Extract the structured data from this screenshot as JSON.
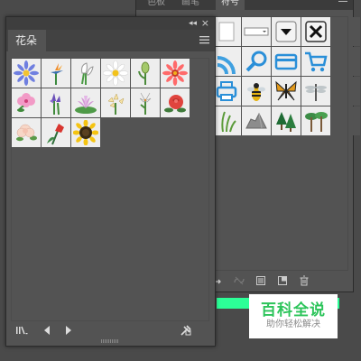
{
  "symbols_panel": {
    "tabs": [
      "色板",
      "画笔",
      "符号"
    ],
    "active_tab": "符号",
    "symbols": [
      {
        "name": "window-box-symbol"
      },
      {
        "name": "dropdown-field-symbol"
      },
      {
        "name": "dropdown-arrow-symbol"
      },
      {
        "name": "close-x-symbol"
      },
      {
        "name": "blank-symbol"
      },
      {
        "name": "rss-feed-symbol"
      },
      {
        "name": "magnifier-symbol"
      },
      {
        "name": "credit-card-symbol"
      },
      {
        "name": "shopping-cart-symbol"
      },
      {
        "name": "blank-symbol"
      },
      {
        "name": "printer-symbol"
      },
      {
        "name": "bee-symbol"
      },
      {
        "name": "butterfly-symbol"
      },
      {
        "name": "dragonfly-symbol"
      },
      {
        "name": "blank-symbol"
      },
      {
        "name": "grass-symbol"
      },
      {
        "name": "rock-symbol"
      },
      {
        "name": "pine-tree-symbol"
      },
      {
        "name": "palm-trees-symbol"
      },
      {
        "name": "blank-symbol"
      }
    ]
  },
  "flowers_panel": {
    "tab_label": "花朵",
    "flowers": [
      {
        "name": "aster",
        "color": "#6f7fe0"
      },
      {
        "name": "bird-of-paradise",
        "color": "#f08a2a"
      },
      {
        "name": "calla-lily",
        "color": "#ffffff"
      },
      {
        "name": "daisy",
        "color": "#ffffff"
      },
      {
        "name": "tulip-bud",
        "color": "#8fbf4a"
      },
      {
        "name": "gerbera",
        "color": "#ff6a6a"
      },
      {
        "name": "hibiscus",
        "color": "#f29ac6"
      },
      {
        "name": "iris",
        "color": "#6a4fb8"
      },
      {
        "name": "lotus",
        "color": "#d59ad8"
      },
      {
        "name": "lily-cluster",
        "color": "#f6e3a6"
      },
      {
        "name": "white-lily",
        "color": "#ffffff"
      },
      {
        "name": "rose",
        "color": "#e0443e"
      },
      {
        "name": "peony",
        "color": "#f7d6c6"
      },
      {
        "name": "red-tulip",
        "color": "#d8352f"
      },
      {
        "name": "sunflower",
        "color": "#f5c412"
      }
    ]
  },
  "watermark": {
    "title": "百科全说",
    "subtitle": "助你轻松解决"
  },
  "colors": {
    "panel_bg": "#535353",
    "accent_green": "#2cff97",
    "watermark_green": "#2cc45a"
  }
}
